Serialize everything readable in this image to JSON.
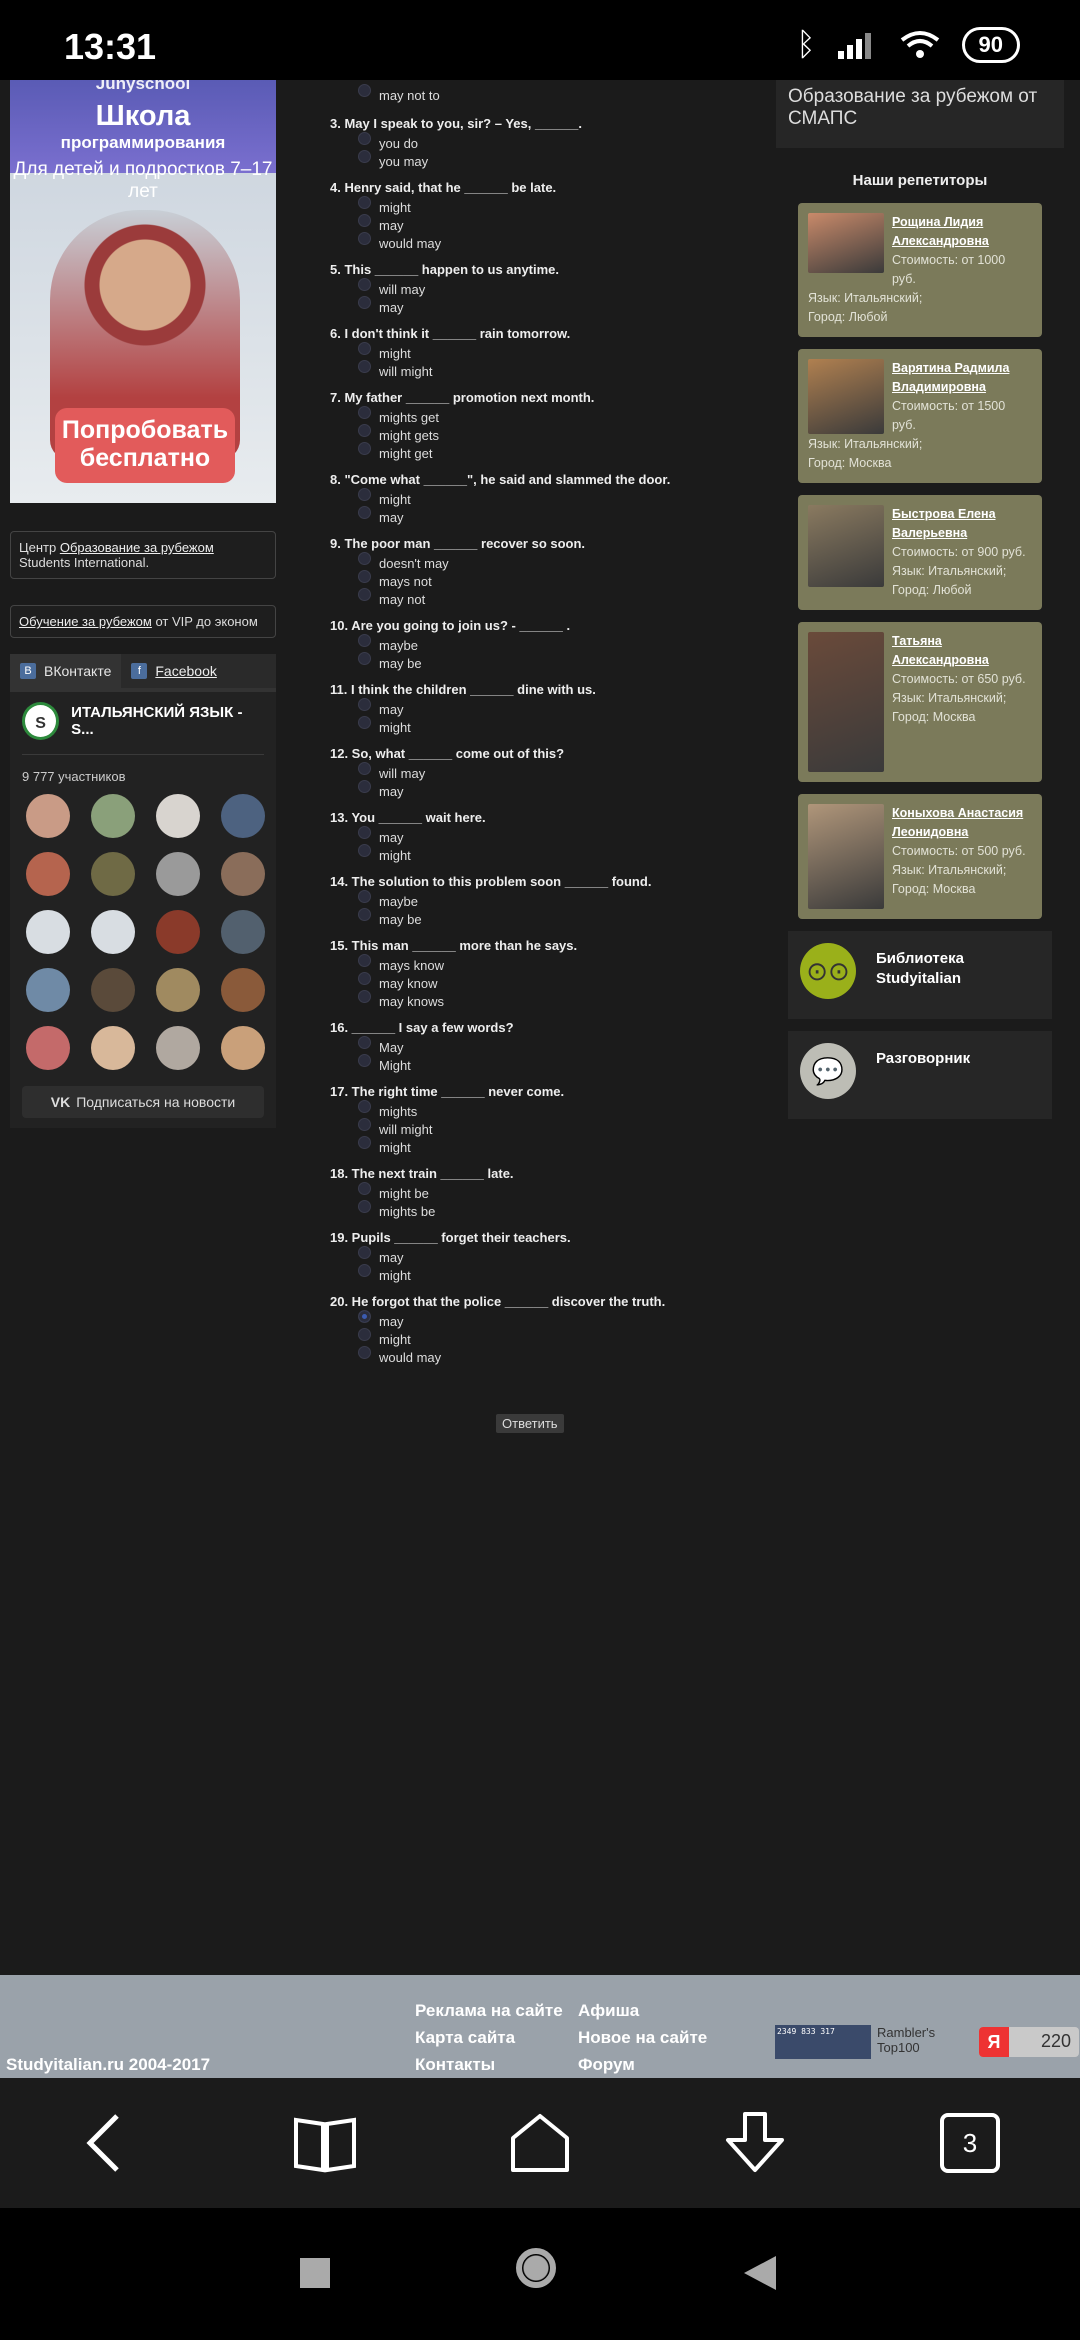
{
  "status": {
    "time": "13:31",
    "battery": "90"
  },
  "left": {
    "ad": {
      "brand": "Junyschool",
      "line1": "Школа",
      "line2": "программирования",
      "line3": "Для детей и подростков 7–17 лет",
      "cta": "Попробовать бесплатно"
    },
    "box1": {
      "prefix": "Центр ",
      "link": "Образование за рубежом",
      "suffix": " Students International."
    },
    "box2": {
      "link": "Обучение за рубежом",
      "suffix": " от VIP до эконом"
    },
    "tabs": {
      "vk": "ВКонтакте",
      "fb": "Facebook"
    },
    "vk": {
      "title": "ИТАЛЬЯНСКИЙ ЯЗЫК - S...",
      "members": "9 777 участников",
      "subscribe": "Подписаться на новости"
    }
  },
  "quiz": {
    "top_option": "may not to",
    "questions": [
      {
        "n": "3.",
        "text": "May I speak to you, sir? – Yes, ______.",
        "options": [
          "you do",
          "you may"
        ]
      },
      {
        "n": "4.",
        "text": "Henry said, that he ______ be late.",
        "options": [
          "might",
          "may",
          "would may"
        ]
      },
      {
        "n": "5.",
        "text": "This ______ happen to us anytime.",
        "options": [
          "will may",
          "may"
        ]
      },
      {
        "n": "6.",
        "text": "I don't think it ______ rain tomorrow.",
        "options": [
          "might",
          "will might"
        ]
      },
      {
        "n": "7.",
        "text": "My father ______ promotion next month.",
        "options": [
          "mights get",
          "might gets",
          "might get"
        ]
      },
      {
        "n": "8.",
        "text": "\"Come what ______\", he said and slammed the door.",
        "options": [
          "might",
          "may"
        ]
      },
      {
        "n": "9.",
        "text": "The poor man ______ recover so soon.",
        "options": [
          "doesn't may",
          "mays not",
          "may not"
        ]
      },
      {
        "n": "10.",
        "text": "Are you going to join us? - ______ .",
        "options": [
          "maybe",
          "may be"
        ]
      },
      {
        "n": "11.",
        "text": "I think the children ______ dine with us.",
        "options": [
          "may",
          "might"
        ]
      },
      {
        "n": "12.",
        "text": "So, what ______ come out of this?",
        "options": [
          "will may",
          "may"
        ]
      },
      {
        "n": "13.",
        "text": "You ______ wait here.",
        "options": [
          "may",
          "might"
        ]
      },
      {
        "n": "14.",
        "text": "The solution to this problem soon ______ found.",
        "options": [
          "maybe",
          "may be"
        ]
      },
      {
        "n": "15.",
        "text": "This man ______ more than he says.",
        "options": [
          "mays know",
          "may know",
          "may knows"
        ]
      },
      {
        "n": "16.",
        "text": "______ I say a few words?",
        "options": [
          "May",
          "Might"
        ]
      },
      {
        "n": "17.",
        "text": "The right time ______ never come.",
        "options": [
          "mights",
          "will might",
          "might"
        ]
      },
      {
        "n": "18.",
        "text": "The next train ______ late.",
        "options": [
          "might be",
          "mights be"
        ]
      },
      {
        "n": "19.",
        "text": "Pupils ______ forget their teachers.",
        "options": [
          "may",
          "might"
        ]
      },
      {
        "n": "20.",
        "text": "He forgot that the police ______ discover the truth.",
        "options": [
          "may",
          "might",
          "would may"
        ],
        "selected": 0
      }
    ],
    "submit": "Ответить"
  },
  "right": {
    "top_link": "Образование за рубежом от СМАПС",
    "reps_title": "Наши репетиторы",
    "reps": [
      {
        "name": "Рощина Лидия Александровна",
        "price": "Стоимость: от 1000 руб.",
        "lang": "Язык: Итальянский;",
        "city": "Город: Любой"
      },
      {
        "name": "Варятина Радмила Владимировна",
        "price": "Стоимость: от 1500 руб.",
        "lang": "Язык: Итальянский;",
        "city": "Город: Москва"
      },
      {
        "name": "Быстрова Елена Валерьевна",
        "price": "Стоимость: от 900 руб.",
        "lang": "Язык: Итальянский;",
        "city": "Город: Любой"
      },
      {
        "name": "Татьяна Александровна",
        "price": "Стоимость: от 650 руб.",
        "lang": "Язык: Итальянский;",
        "city": "Город: Москва"
      },
      {
        "name": "Коныхова Анастасия Леонидовна",
        "price": "Стоимость: от 500 руб.",
        "lang": "Язык: Итальянский;",
        "city": "Город: Москва"
      }
    ],
    "library": "Библиотека Studyitalian",
    "phrasebook": "Разговорник"
  },
  "footer": {
    "copyright": "Studyitalian.ru 2004-2017",
    "col1": [
      "Реклама на сайте",
      "Карта сайта",
      "Контакты"
    ],
    "col2": [
      "Афиша",
      "Новое на сайте",
      "Форум"
    ],
    "counter1": "2349 833 317",
    "rambler": "Rambler's Top100",
    "yandex_letter": "Я",
    "yandex_count": "220"
  },
  "nav": {
    "tabs_count": "3"
  }
}
